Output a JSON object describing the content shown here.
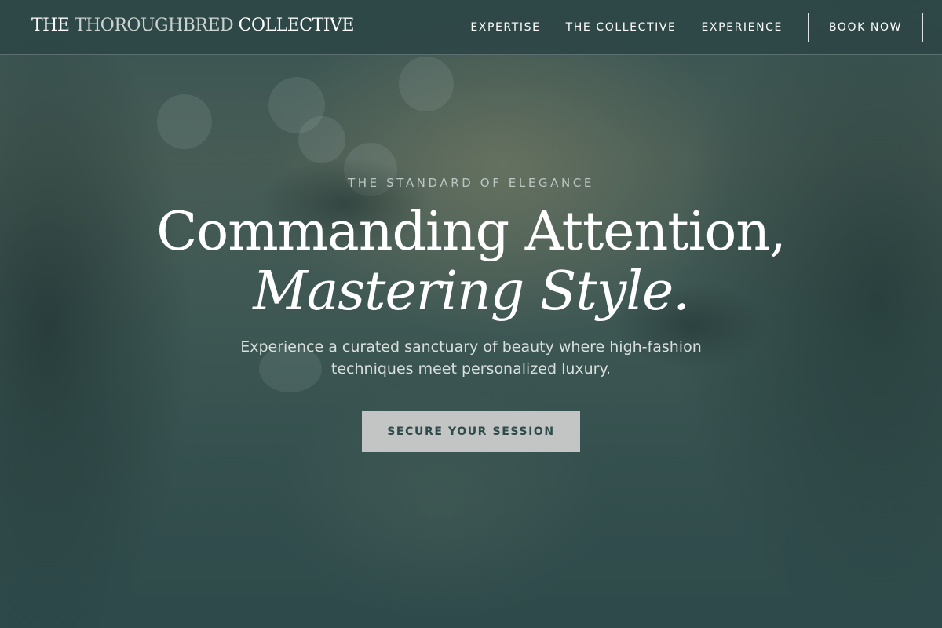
{
  "brand": {
    "word_the": "THE",
    "word_thoroughbred": "THOROUGHBRED",
    "word_collective": "COLLECTIVE"
  },
  "nav": {
    "items": [
      {
        "label": "EXPERTISE"
      },
      {
        "label": "THE COLLECTIVE"
      },
      {
        "label": "EXPERIENCE"
      }
    ],
    "book_label": "BOOK NOW"
  },
  "hero": {
    "eyebrow": "THE STANDARD OF ELEGANCE",
    "headline_line1": "Commanding Attention,",
    "headline_line2": "Mastering Style.",
    "subtext": "Experience a curated sanctuary of beauty where high-fashion techniques meet personalized luxury.",
    "cta_label": "SECURE YOUR SESSION"
  },
  "colors": {
    "background": "#2f4a4a",
    "nav_bar": "#2c4646",
    "cta_fill": "#c3c5c4",
    "cta_text": "#2f4a4a"
  }
}
